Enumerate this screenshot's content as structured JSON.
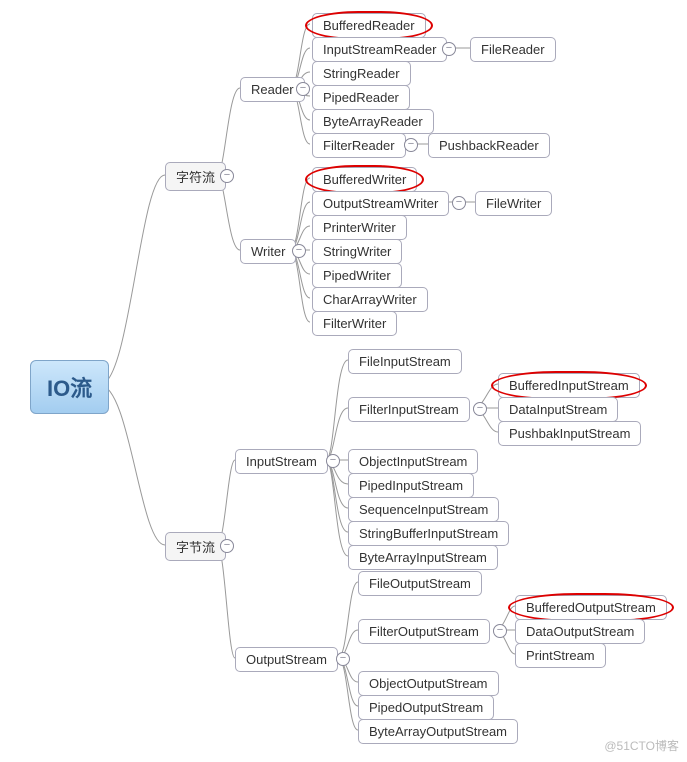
{
  "root": "IO流",
  "charStream": "字符流",
  "byteStream": "字节流",
  "reader": "Reader",
  "writer": "Writer",
  "inputStream": "InputStream",
  "outputStream": "OutputStream",
  "r": {
    "bufferedReader": "BufferedReader",
    "inputStreamReader": "InputStreamReader",
    "fileReader": "FileReader",
    "stringReader": "StringReader",
    "pipedReader": "PipedReader",
    "byteArrayReader": "ByteArrayReader",
    "filterReader": "FilterReader",
    "pushbackReader": "PushbackReader"
  },
  "w": {
    "bufferedWriter": "BufferedWriter",
    "outputStreamWriter": "OutputStreamWriter",
    "fileWriter": "FileWriter",
    "printerWriter": "PrinterWriter",
    "stringWriter": "StringWriter",
    "pipedWriter": "PipedWriter",
    "charArrayWriter": "CharArrayWriter",
    "filterWriter": "FilterWriter"
  },
  "is": {
    "fileInputStream": "FileInputStream",
    "filterInputStream": "FilterInputStream",
    "bufferedInputStream": "BufferedInputStream",
    "dataInputStream": "DataInputStream",
    "pushbakInputStream": "PushbakInputStream",
    "objectInputStream": "ObjectInputStream",
    "pipedInputStream": "PipedInputStream",
    "sequenceInputStream": "SequenceInputStream",
    "stringBufferInputStream": "StringBufferInputStream",
    "byteArrayInputStream": "ByteArrayInputStream"
  },
  "os": {
    "fileOutputStream": "FileOutputStream",
    "filterOutputStream": "FilterOutputStream",
    "bufferedOutputStream": "BufferedOutputStream",
    "dataOutputStream": "DataOutputStream",
    "printStream": "PrintStream",
    "objectOutputStream": "ObjectOutputStream",
    "pipedOutputStream": "PipedOutputStream",
    "byteArrayOutputStream": "ByteArrayOutputStream"
  },
  "minus": "−",
  "watermark": "@51CTO博客"
}
